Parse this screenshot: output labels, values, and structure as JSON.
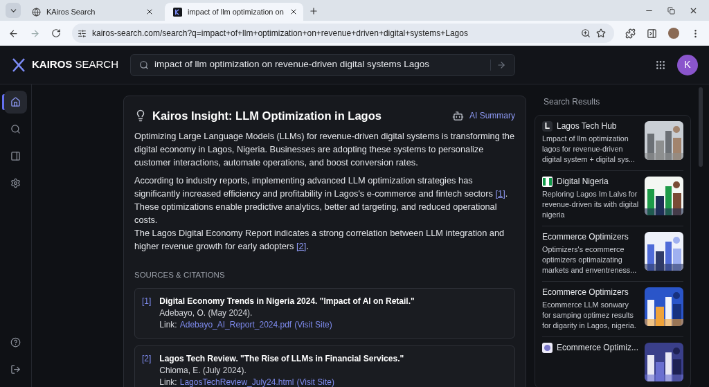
{
  "browser": {
    "tabs": [
      {
        "title": "KAiros Search",
        "kind": "globe",
        "selected": false
      },
      {
        "title": "impact of llm optimization on",
        "kind": "logo",
        "selected": true
      }
    ],
    "url": "kairos-search.com/search?q=impact+of+llm+optimization+on+revenue+driven+digital+systems+Lagos"
  },
  "header": {
    "brand": "KAIROS",
    "brand_suffix": "SEARCH",
    "query": "impact of llm optimization on revenue-driven digital systems Lagos",
    "avatar": "K"
  },
  "sidebar": {
    "items": [
      {
        "kind": "home",
        "selected": true
      },
      {
        "kind": "search",
        "selected": false
      },
      {
        "kind": "panel",
        "selected": false
      },
      {
        "kind": "settings",
        "selected": false
      }
    ],
    "bottom": [
      {
        "kind": "help"
      },
      {
        "kind": "logout"
      }
    ]
  },
  "insight": {
    "title": "Kairos Insight: LLM Optimization in Lagos",
    "badge": "AI Summary",
    "paragraphs": [
      {
        "segments": [
          {
            "kind": "text",
            "text": "Optimizing Large Language Models (LLMs) for revenue-driven digital systems is transforming the digital economy in Lagos, Nigeria. Businesses are adopting these systems to personalize customer interactions, automate operations, and boost conversion rates."
          }
        ]
      },
      {
        "segments": [
          {
            "kind": "text",
            "text": "According to industry reports, implementing advanced LLM optimization strategies has significantly increased efficiency and profitability in Lagos's e-commerce and fintech sectors "
          },
          {
            "kind": "cite",
            "text": "[1]"
          },
          {
            "kind": "text",
            "text": ". These optimizations enable predictive analytics, better ad targeting, and reduced operational costs."
          },
          {
            "kind": "break"
          },
          {
            "kind": "text",
            "text": "The Lagos Digital Economy Report indicates a strong correlation between LLM integration and higher revenue growth for early adopters "
          },
          {
            "kind": "cite",
            "text": "[2]"
          },
          {
            "kind": "text",
            "text": "."
          }
        ]
      }
    ],
    "sources_heading": "SOURCES & CITATIONS",
    "sources": [
      {
        "index": "[1]",
        "title": "Digital Economy Trends in Nigeria 2024. \"Impact of AI on Retail.\"",
        "author": "Adebayo, O. (May 2024).",
        "link_label": "Link:",
        "file": "Adebayo_AI_Report_2024.pdf",
        "visit": "(Visit Site)"
      },
      {
        "index": "[2]",
        "title": "Lagos Tech Review. \"The Rise of LLMs in Financial Services.\"",
        "author": "Chioma, E. (July 2024).",
        "link_label": "Link:",
        "file": "LagosTechReview_July24.html",
        "visit": "(Visit Site)"
      }
    ]
  },
  "results": {
    "heading": "Search Results",
    "items": [
      {
        "kind": "letter",
        "favicon_text": "L",
        "source": "Lagos Tech Hub",
        "snippet": "Lmpact of llm optimization lagos for revenue-driven digital system + digital sys..."
      },
      {
        "kind": "flag",
        "source": "Digital Nigeria",
        "snippet": "Reploring Lagos Im Lalvs for revenue-driven its with digital nigeria"
      },
      {
        "kind": "plain",
        "source": "Ecommerce Optimizers",
        "snippet": "Optimizers's ecommerce optimizers optimaizating markets and enventreness..."
      },
      {
        "kind": "plain",
        "source": "Ecommerce Optimizers",
        "snippet": "Ecommerce LLM sonwary for samping optimez results for digarity in Lagos, nigeria."
      },
      {
        "kind": "badge",
        "source": "Ecommerce Optimiz..."
      }
    ]
  }
}
